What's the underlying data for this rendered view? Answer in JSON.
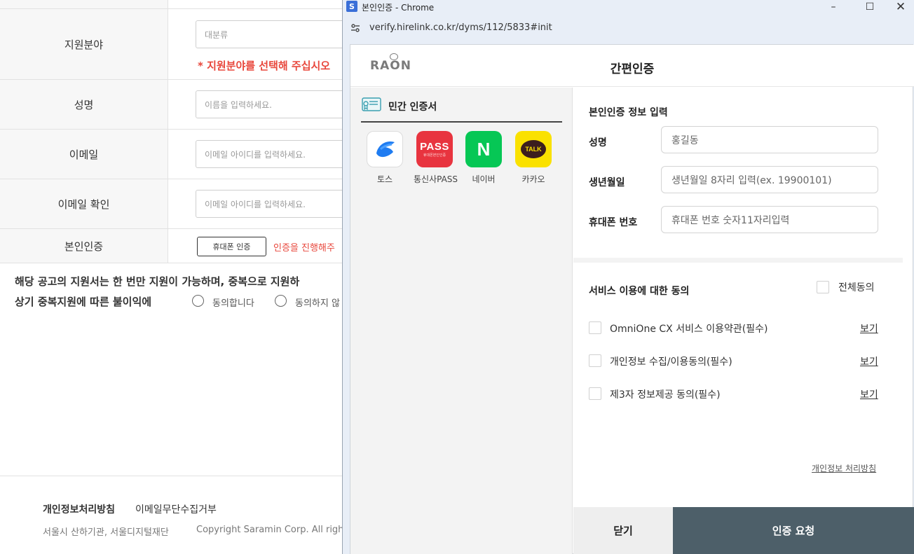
{
  "background_page": {
    "fields": {
      "field_label": "지원분야",
      "field_placeholder": "대분류",
      "field_required_msg": "* 지원분야를 선택해 주십시오",
      "name_label": "성명",
      "name_placeholder": "이름을 입력하세요.",
      "email_label": "이메일",
      "email_placeholder": "이메일 아이디를 입력하세요.",
      "email_confirm_label": "이메일 확인",
      "email_confirm_placeholder": "이메일 아이디를 입력하세요.",
      "verify_label": "본인인증",
      "verify_button": "휴대폰 인증",
      "verify_msg": "인증을 진행해주"
    },
    "notice_line1": "해당 공고의 지원서는 한 번만 지원이 가능하며, 중복으로 지원하",
    "notice_line2": "상기 중복지원에 따른 불이익에",
    "radio_agree": "동의합니다",
    "radio_disagree": "동의하지 않",
    "footer": {
      "privacy": "개인정보처리방침",
      "email_refusal": "이메일무단수집거부",
      "address": "서울시 산하기관, 서울디지털재단",
      "copyright": "Copyright Saramin Corp. All rights r"
    }
  },
  "window": {
    "app_icon": "S",
    "title": "본인인증 - Chrome",
    "url": "verify.hirelink.co.kr/dyms/112/5833#init",
    "controls": [
      "minimize-icon",
      "maximize-icon",
      "close-icon"
    ]
  },
  "modal": {
    "logo": "RAON",
    "title": "간편인증",
    "left_tab": "민간 인증서",
    "providers": [
      {
        "label": "토스",
        "logo_text": "",
        "color": "#ffffff"
      },
      {
        "label": "통신사PASS",
        "logo_text": "PASS",
        "logo_sub": "휴대폰본인인증",
        "color": "#e8343f"
      },
      {
        "label": "네이버",
        "logo_text": "N",
        "color": "#06c755"
      },
      {
        "label": "카카오",
        "logo_text": "TALK",
        "color": "#fae100"
      }
    ],
    "info_section_title": "본인인증 정보 입력",
    "name_label": "성명",
    "name_value": "홍길동",
    "birth_label": "생년월일",
    "birth_placeholder": "생년월일 8자리 입력(ex. 19900101)",
    "phone_label": "휴대폰 번호",
    "phone_placeholder": "휴대폰 번호 숫자11자리입력",
    "consent_title": "서비스 이용에 대한 동의",
    "agree_all": "전체동의",
    "agreements": [
      {
        "text": "OmniOne CX 서비스 이용약관(필수)",
        "link": "보기"
      },
      {
        "text": "개인정보 수집/이용동의(필수)",
        "link": "보기"
      },
      {
        "text": "제3자 정보제공 동의(필수)",
        "link": "보기"
      }
    ],
    "privacy_link": "개인정보 처리방침",
    "close_button": "닫기",
    "request_button": "인증 요청"
  }
}
